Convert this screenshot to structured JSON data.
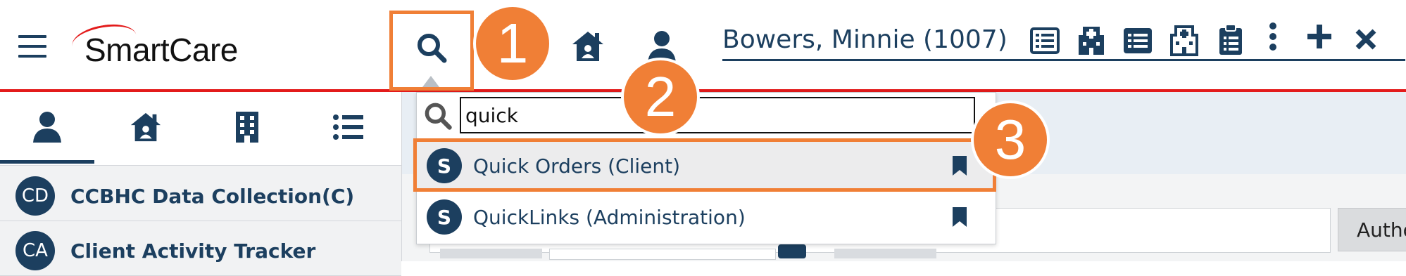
{
  "header": {
    "app_name": "SmartCare",
    "client_name": "Bowers, Minnie (1007)"
  },
  "callouts": [
    "1",
    "2",
    "3"
  ],
  "left_panel": {
    "tabs": [
      {
        "icon": "person-icon"
      },
      {
        "icon": "home-icon"
      },
      {
        "icon": "building-icon"
      },
      {
        "icon": "list-icon"
      }
    ],
    "items": [
      {
        "initials": "CD",
        "label": "CCBHC Data Collection(C)"
      },
      {
        "initials": "CA",
        "label": "Client Activity Tracker"
      }
    ]
  },
  "search": {
    "query": "quick",
    "results": [
      {
        "initial": "S",
        "label": "Quick Orders (Client)"
      },
      {
        "initial": "S",
        "label": "QuickLinks (Administration)"
      }
    ]
  },
  "main": {
    "button_label": "Autho"
  },
  "colors": {
    "primary": "#1c3f5f",
    "accent_red": "#e31b1b",
    "callout_orange": "#f07f36"
  }
}
